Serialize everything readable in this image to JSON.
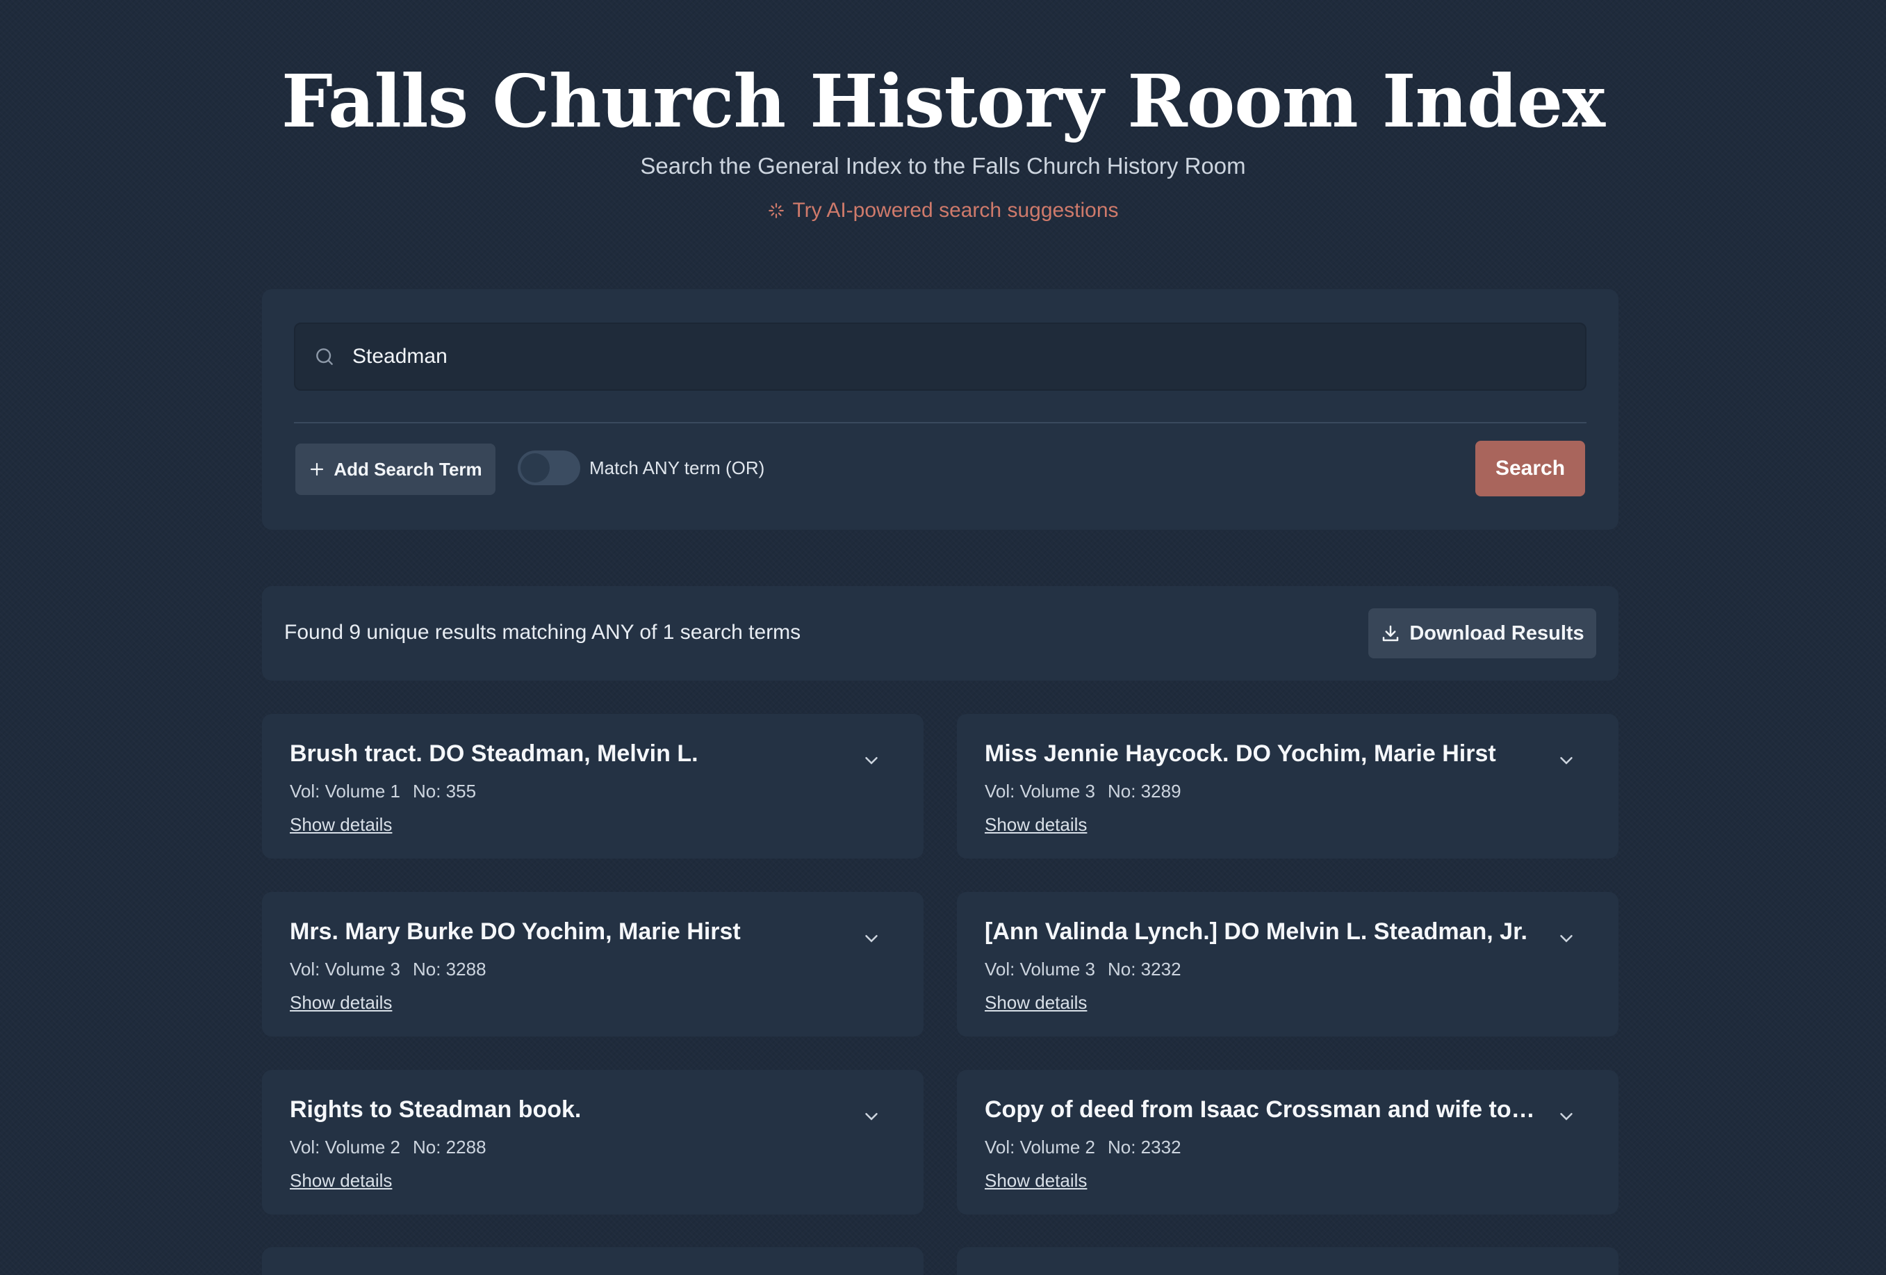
{
  "header": {
    "title": "Falls Church History Room Index",
    "subtitle": "Search the General Index to the Falls Church History Room",
    "ai_link": "Try AI-powered search suggestions"
  },
  "search": {
    "value": "Steadman",
    "add_term_label": "Add Search Term",
    "toggle_label": "Match ANY term (OR)",
    "toggle_on": false,
    "search_button": "Search"
  },
  "results": {
    "summary": "Found 9 unique results matching ANY of 1 search terms",
    "download_label": "Download Results",
    "items": [
      {
        "title": "Brush tract. DO Steadman, Melvin L.",
        "vol": "Vol: Volume 1",
        "no": "No: 355",
        "details": "Show details"
      },
      {
        "title": "Miss Jennie Haycock. DO Yochim, Marie Hirst",
        "vol": "Vol: Volume 3",
        "no": "No: 3289",
        "details": "Show details"
      },
      {
        "title": "Mrs. Mary Burke DO Yochim, Marie Hirst",
        "vol": "Vol: Volume 3",
        "no": "No: 3288",
        "details": "Show details"
      },
      {
        "title": "[Ann Valinda Lynch.] DO Melvin L. Steadman, Jr.",
        "vol": "Vol: Volume 3",
        "no": "No: 3232",
        "details": "Show details"
      },
      {
        "title": "Rights to Steadman book.",
        "vol": "Vol: Volume 2",
        "no": "No: 2288",
        "details": "Show details"
      },
      {
        "title": "Copy of deed from Isaac Crossman and wife to th...",
        "vol": "Vol: Volume 2",
        "no": "No: 2332",
        "details": "Show details"
      }
    ]
  },
  "colors": {
    "accent": "#a9655c",
    "ai_link": "#cf7a6b",
    "panel": "#243244",
    "background": "#1f2b3c"
  },
  "icons": {
    "search": "search-icon",
    "sparkle": "sparkle-icon",
    "plus": "plus-icon",
    "download": "download-icon",
    "chevron": "chevron-down-icon"
  }
}
